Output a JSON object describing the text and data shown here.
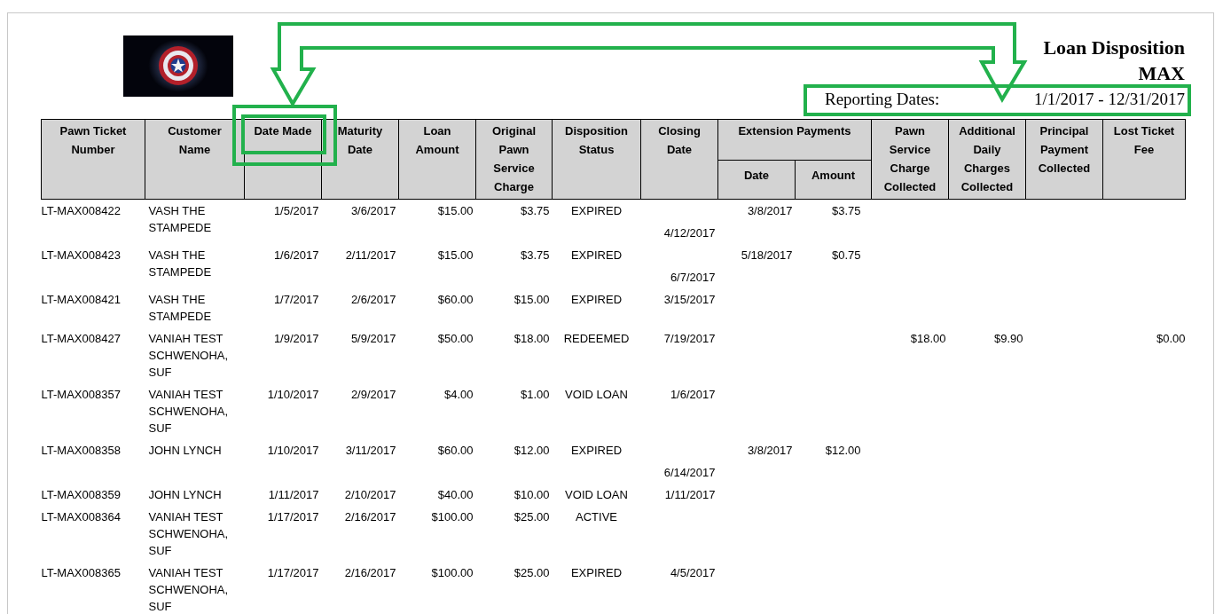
{
  "report": {
    "title": "Loan Disposition",
    "store": "MAX",
    "reporting_label": "Reporting Dates:",
    "reporting_range": "1/1/2017 - 12/31/2017"
  },
  "table": {
    "columns": [
      {
        "label": "Pawn Ticket Number"
      },
      {
        "label": "Customer Name"
      },
      {
        "label": "Date Made"
      },
      {
        "label": "Maturity Date"
      },
      {
        "label": "Loan Amount"
      },
      {
        "label": "Original Pawn Service Charge"
      },
      {
        "label": "Disposition Status"
      },
      {
        "label": "Closing Date"
      },
      {
        "label": "Extension Payments",
        "children": [
          {
            "label": "Date"
          },
          {
            "label": "Amount"
          }
        ]
      },
      {
        "label": "Pawn Service Charge Collected"
      },
      {
        "label": "Additional Daily Charges Collected"
      },
      {
        "label": "Principal Payment Collected"
      },
      {
        "label": "Lost Ticket Fee"
      }
    ],
    "rows": [
      {
        "ticket": "LT-MAX008422",
        "customer": "VASH THE STAMPEDE",
        "date_made": "1/5/2017",
        "maturity_date": "3/6/2017",
        "loan_amount": "$15.00",
        "original_charge": "$3.75",
        "status": "EXPIRED",
        "closing_date": "4/12/2017",
        "ext_date": "3/8/2017",
        "ext_amount": "$3.75"
      },
      {
        "ticket": "LT-MAX008423",
        "customer": "VASH THE STAMPEDE",
        "date_made": "1/6/2017",
        "maturity_date": "2/11/2017",
        "loan_amount": "$15.00",
        "original_charge": "$3.75",
        "status": "EXPIRED",
        "closing_date": "6/7/2017",
        "ext_date": "5/18/2017",
        "ext_amount": "$0.75"
      },
      {
        "ticket": "LT-MAX008421",
        "customer": "VASH THE STAMPEDE",
        "date_made": "1/7/2017",
        "maturity_date": "2/6/2017",
        "loan_amount": "$60.00",
        "original_charge": "$15.00",
        "status": "EXPIRED",
        "closing_date": "3/15/2017"
      },
      {
        "ticket": "LT-MAX008427",
        "customer": "VANIAH TEST SCHWENOHA, SUF",
        "date_made": "1/9/2017",
        "maturity_date": "5/9/2017",
        "loan_amount": "$50.00",
        "original_charge": "$18.00",
        "status": "REDEEMED",
        "closing_date": "7/19/2017",
        "service_charge_collected": "$18.00",
        "daily_charges_collected": "$9.90",
        "lost_ticket_fee": "$0.00"
      },
      {
        "ticket": "LT-MAX008357",
        "customer": "VANIAH TEST SCHWENOHA, SUF",
        "date_made": "1/10/2017",
        "maturity_date": "2/9/2017",
        "loan_amount": "$4.00",
        "original_charge": "$1.00",
        "status": "VOID LOAN",
        "closing_date": "1/6/2017"
      },
      {
        "ticket": "LT-MAX008358",
        "customer": "JOHN LYNCH",
        "date_made": "1/10/2017",
        "maturity_date": "3/11/2017",
        "loan_amount": "$60.00",
        "original_charge": "$12.00",
        "status": "EXPIRED",
        "closing_date": "6/14/2017",
        "ext_date": "3/8/2017",
        "ext_amount": "$12.00"
      },
      {
        "ticket": "LT-MAX008359",
        "customer": "JOHN LYNCH",
        "date_made": "1/11/2017",
        "maturity_date": "2/10/2017",
        "loan_amount": "$40.00",
        "original_charge": "$10.00",
        "status": "VOID LOAN",
        "closing_date": "1/11/2017"
      },
      {
        "ticket": "LT-MAX008364",
        "customer": "VANIAH TEST SCHWENOHA, SUF",
        "date_made": "1/17/2017",
        "maturity_date": "2/16/2017",
        "loan_amount": "$100.00",
        "original_charge": "$25.00",
        "status": "ACTIVE"
      },
      {
        "ticket": "LT-MAX008365",
        "customer": "VANIAH TEST SCHWENOHA, SUF",
        "date_made": "1/17/2017",
        "maturity_date": "2/16/2017",
        "loan_amount": "$100.00",
        "original_charge": "$25.00",
        "status": "EXPIRED",
        "closing_date": "4/5/2017"
      }
    ]
  }
}
